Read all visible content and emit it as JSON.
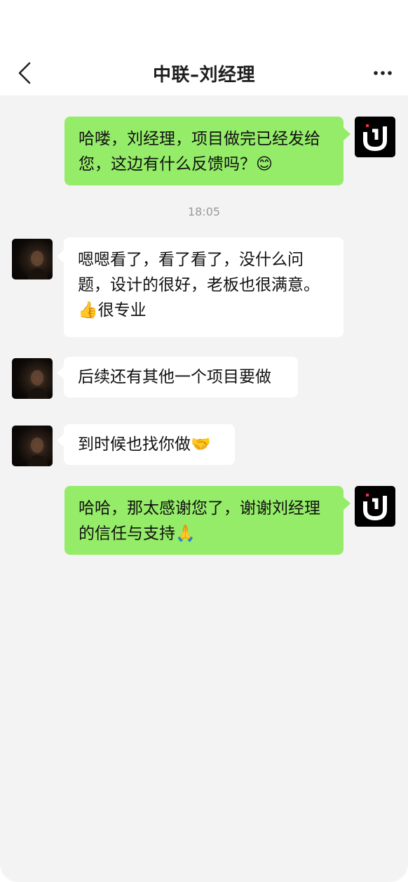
{
  "header": {
    "title": "中联–刘经理",
    "back_icon": "chevron-left-icon",
    "more_icon": "more-dots-icon"
  },
  "chat": {
    "timestamp": "18:05",
    "messages": [
      {
        "sender": "me",
        "text": "哈喽，刘经理，项目做完已经发给您，这边有什么反馈吗？😊"
      },
      {
        "sender": "other",
        "text": "嗯嗯看了，看了看了，没什么问题，设计的很好，老板也很满意。👍很专业"
      },
      {
        "sender": "other",
        "text": "后续还有其他一个项目要做"
      },
      {
        "sender": "other",
        "text": "到时候也找你做🤝"
      },
      {
        "sender": "me",
        "text": "哈哈，那太感谢您了，谢谢刘经理的信任与支持🙏"
      }
    ]
  },
  "colors": {
    "outgoing_bubble": "#95ec69",
    "incoming_bubble": "#ffffff",
    "chat_background": "#f3f3f3",
    "my_avatar_accent": "#e8334a"
  }
}
